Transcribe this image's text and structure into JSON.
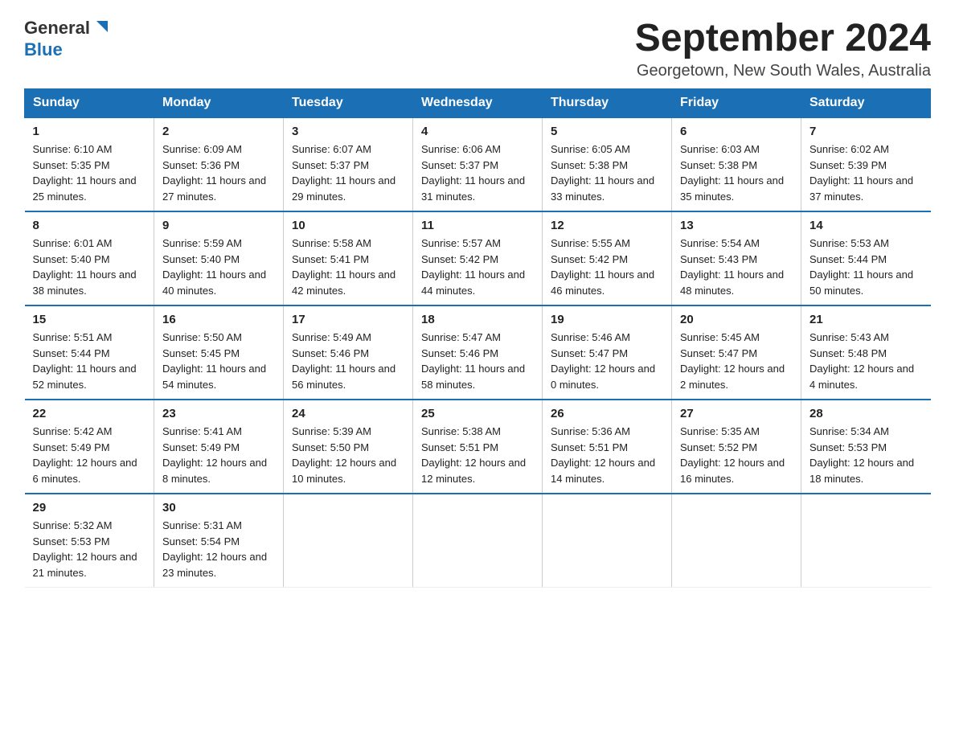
{
  "header": {
    "logo_general": "General",
    "logo_triangle": "▲",
    "logo_blue": "Blue",
    "month_title": "September 2024",
    "location": "Georgetown, New South Wales, Australia"
  },
  "weekdays": [
    "Sunday",
    "Monday",
    "Tuesday",
    "Wednesday",
    "Thursday",
    "Friday",
    "Saturday"
  ],
  "weeks": [
    [
      {
        "day": "1",
        "sunrise": "Sunrise: 6:10 AM",
        "sunset": "Sunset: 5:35 PM",
        "daylight": "Daylight: 11 hours and 25 minutes."
      },
      {
        "day": "2",
        "sunrise": "Sunrise: 6:09 AM",
        "sunset": "Sunset: 5:36 PM",
        "daylight": "Daylight: 11 hours and 27 minutes."
      },
      {
        "day": "3",
        "sunrise": "Sunrise: 6:07 AM",
        "sunset": "Sunset: 5:37 PM",
        "daylight": "Daylight: 11 hours and 29 minutes."
      },
      {
        "day": "4",
        "sunrise": "Sunrise: 6:06 AM",
        "sunset": "Sunset: 5:37 PM",
        "daylight": "Daylight: 11 hours and 31 minutes."
      },
      {
        "day": "5",
        "sunrise": "Sunrise: 6:05 AM",
        "sunset": "Sunset: 5:38 PM",
        "daylight": "Daylight: 11 hours and 33 minutes."
      },
      {
        "day": "6",
        "sunrise": "Sunrise: 6:03 AM",
        "sunset": "Sunset: 5:38 PM",
        "daylight": "Daylight: 11 hours and 35 minutes."
      },
      {
        "day": "7",
        "sunrise": "Sunrise: 6:02 AM",
        "sunset": "Sunset: 5:39 PM",
        "daylight": "Daylight: 11 hours and 37 minutes."
      }
    ],
    [
      {
        "day": "8",
        "sunrise": "Sunrise: 6:01 AM",
        "sunset": "Sunset: 5:40 PM",
        "daylight": "Daylight: 11 hours and 38 minutes."
      },
      {
        "day": "9",
        "sunrise": "Sunrise: 5:59 AM",
        "sunset": "Sunset: 5:40 PM",
        "daylight": "Daylight: 11 hours and 40 minutes."
      },
      {
        "day": "10",
        "sunrise": "Sunrise: 5:58 AM",
        "sunset": "Sunset: 5:41 PM",
        "daylight": "Daylight: 11 hours and 42 minutes."
      },
      {
        "day": "11",
        "sunrise": "Sunrise: 5:57 AM",
        "sunset": "Sunset: 5:42 PM",
        "daylight": "Daylight: 11 hours and 44 minutes."
      },
      {
        "day": "12",
        "sunrise": "Sunrise: 5:55 AM",
        "sunset": "Sunset: 5:42 PM",
        "daylight": "Daylight: 11 hours and 46 minutes."
      },
      {
        "day": "13",
        "sunrise": "Sunrise: 5:54 AM",
        "sunset": "Sunset: 5:43 PM",
        "daylight": "Daylight: 11 hours and 48 minutes."
      },
      {
        "day": "14",
        "sunrise": "Sunrise: 5:53 AM",
        "sunset": "Sunset: 5:44 PM",
        "daylight": "Daylight: 11 hours and 50 minutes."
      }
    ],
    [
      {
        "day": "15",
        "sunrise": "Sunrise: 5:51 AM",
        "sunset": "Sunset: 5:44 PM",
        "daylight": "Daylight: 11 hours and 52 minutes."
      },
      {
        "day": "16",
        "sunrise": "Sunrise: 5:50 AM",
        "sunset": "Sunset: 5:45 PM",
        "daylight": "Daylight: 11 hours and 54 minutes."
      },
      {
        "day": "17",
        "sunrise": "Sunrise: 5:49 AM",
        "sunset": "Sunset: 5:46 PM",
        "daylight": "Daylight: 11 hours and 56 minutes."
      },
      {
        "day": "18",
        "sunrise": "Sunrise: 5:47 AM",
        "sunset": "Sunset: 5:46 PM",
        "daylight": "Daylight: 11 hours and 58 minutes."
      },
      {
        "day": "19",
        "sunrise": "Sunrise: 5:46 AM",
        "sunset": "Sunset: 5:47 PM",
        "daylight": "Daylight: 12 hours and 0 minutes."
      },
      {
        "day": "20",
        "sunrise": "Sunrise: 5:45 AM",
        "sunset": "Sunset: 5:47 PM",
        "daylight": "Daylight: 12 hours and 2 minutes."
      },
      {
        "day": "21",
        "sunrise": "Sunrise: 5:43 AM",
        "sunset": "Sunset: 5:48 PM",
        "daylight": "Daylight: 12 hours and 4 minutes."
      }
    ],
    [
      {
        "day": "22",
        "sunrise": "Sunrise: 5:42 AM",
        "sunset": "Sunset: 5:49 PM",
        "daylight": "Daylight: 12 hours and 6 minutes."
      },
      {
        "day": "23",
        "sunrise": "Sunrise: 5:41 AM",
        "sunset": "Sunset: 5:49 PM",
        "daylight": "Daylight: 12 hours and 8 minutes."
      },
      {
        "day": "24",
        "sunrise": "Sunrise: 5:39 AM",
        "sunset": "Sunset: 5:50 PM",
        "daylight": "Daylight: 12 hours and 10 minutes."
      },
      {
        "day": "25",
        "sunrise": "Sunrise: 5:38 AM",
        "sunset": "Sunset: 5:51 PM",
        "daylight": "Daylight: 12 hours and 12 minutes."
      },
      {
        "day": "26",
        "sunrise": "Sunrise: 5:36 AM",
        "sunset": "Sunset: 5:51 PM",
        "daylight": "Daylight: 12 hours and 14 minutes."
      },
      {
        "day": "27",
        "sunrise": "Sunrise: 5:35 AM",
        "sunset": "Sunset: 5:52 PM",
        "daylight": "Daylight: 12 hours and 16 minutes."
      },
      {
        "day": "28",
        "sunrise": "Sunrise: 5:34 AM",
        "sunset": "Sunset: 5:53 PM",
        "daylight": "Daylight: 12 hours and 18 minutes."
      }
    ],
    [
      {
        "day": "29",
        "sunrise": "Sunrise: 5:32 AM",
        "sunset": "Sunset: 5:53 PM",
        "daylight": "Daylight: 12 hours and 21 minutes."
      },
      {
        "day": "30",
        "sunrise": "Sunrise: 5:31 AM",
        "sunset": "Sunset: 5:54 PM",
        "daylight": "Daylight: 12 hours and 23 minutes."
      },
      null,
      null,
      null,
      null,
      null
    ]
  ]
}
